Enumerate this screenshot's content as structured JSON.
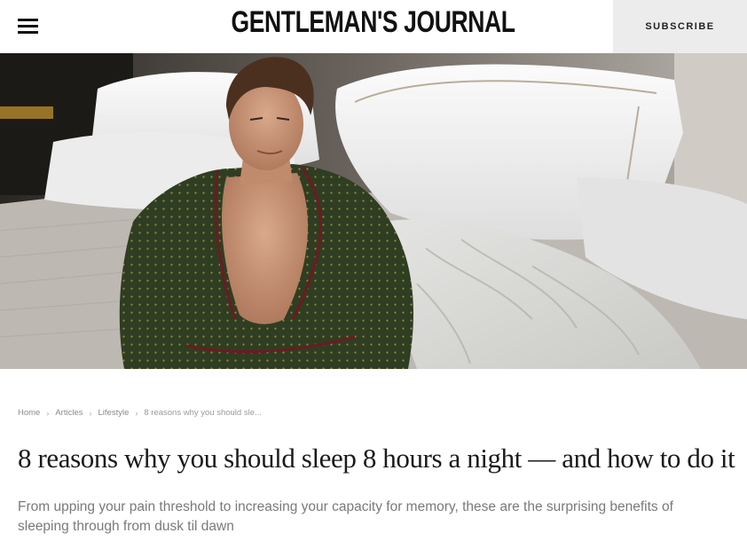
{
  "header": {
    "logo": "GENTLEMAN'S JOURNAL",
    "subscribe_label": "SUBSCRIBE",
    "menu_icon": "hamburger-menu-icon"
  },
  "hero": {
    "image": "man-in-green-silk-robe-on-bed-photo"
  },
  "breadcrumb": {
    "items": [
      "Home",
      "Articles",
      "Lifestyle"
    ],
    "current": "8 reasons why you should sle...",
    "separator_icon": "chevron-right-icon"
  },
  "article": {
    "title": "8 reasons why you should sleep 8 hours a night — and how to do it",
    "subtitle": "From upping your pain threshold to increasing your capacity for memory, these are the surprising benefits of sleeping through from dusk til dawn"
  }
}
